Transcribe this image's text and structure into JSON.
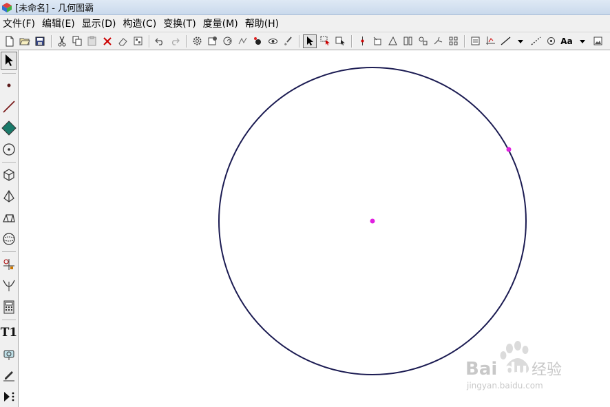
{
  "window": {
    "title": "[未命名] - 几何图霸"
  },
  "menu": {
    "items": [
      {
        "label": "文件(F)"
      },
      {
        "label": "编辑(E)"
      },
      {
        "label": "显示(D)"
      },
      {
        "label": "构造(C)"
      },
      {
        "label": "变换(T)"
      },
      {
        "label": "度量(M)"
      },
      {
        "label": "帮助(H)"
      }
    ]
  },
  "toolbar": {
    "text_style_label": "Aa"
  },
  "toolbox": {
    "text_tool_label": "T1"
  },
  "watermark": {
    "brand": "Baidu经验",
    "url": "jingyan.baidu.com"
  },
  "colors": {
    "circle_stroke": "#1b1b52",
    "point_fill": "#e020e0",
    "accent": "#2060c0"
  }
}
